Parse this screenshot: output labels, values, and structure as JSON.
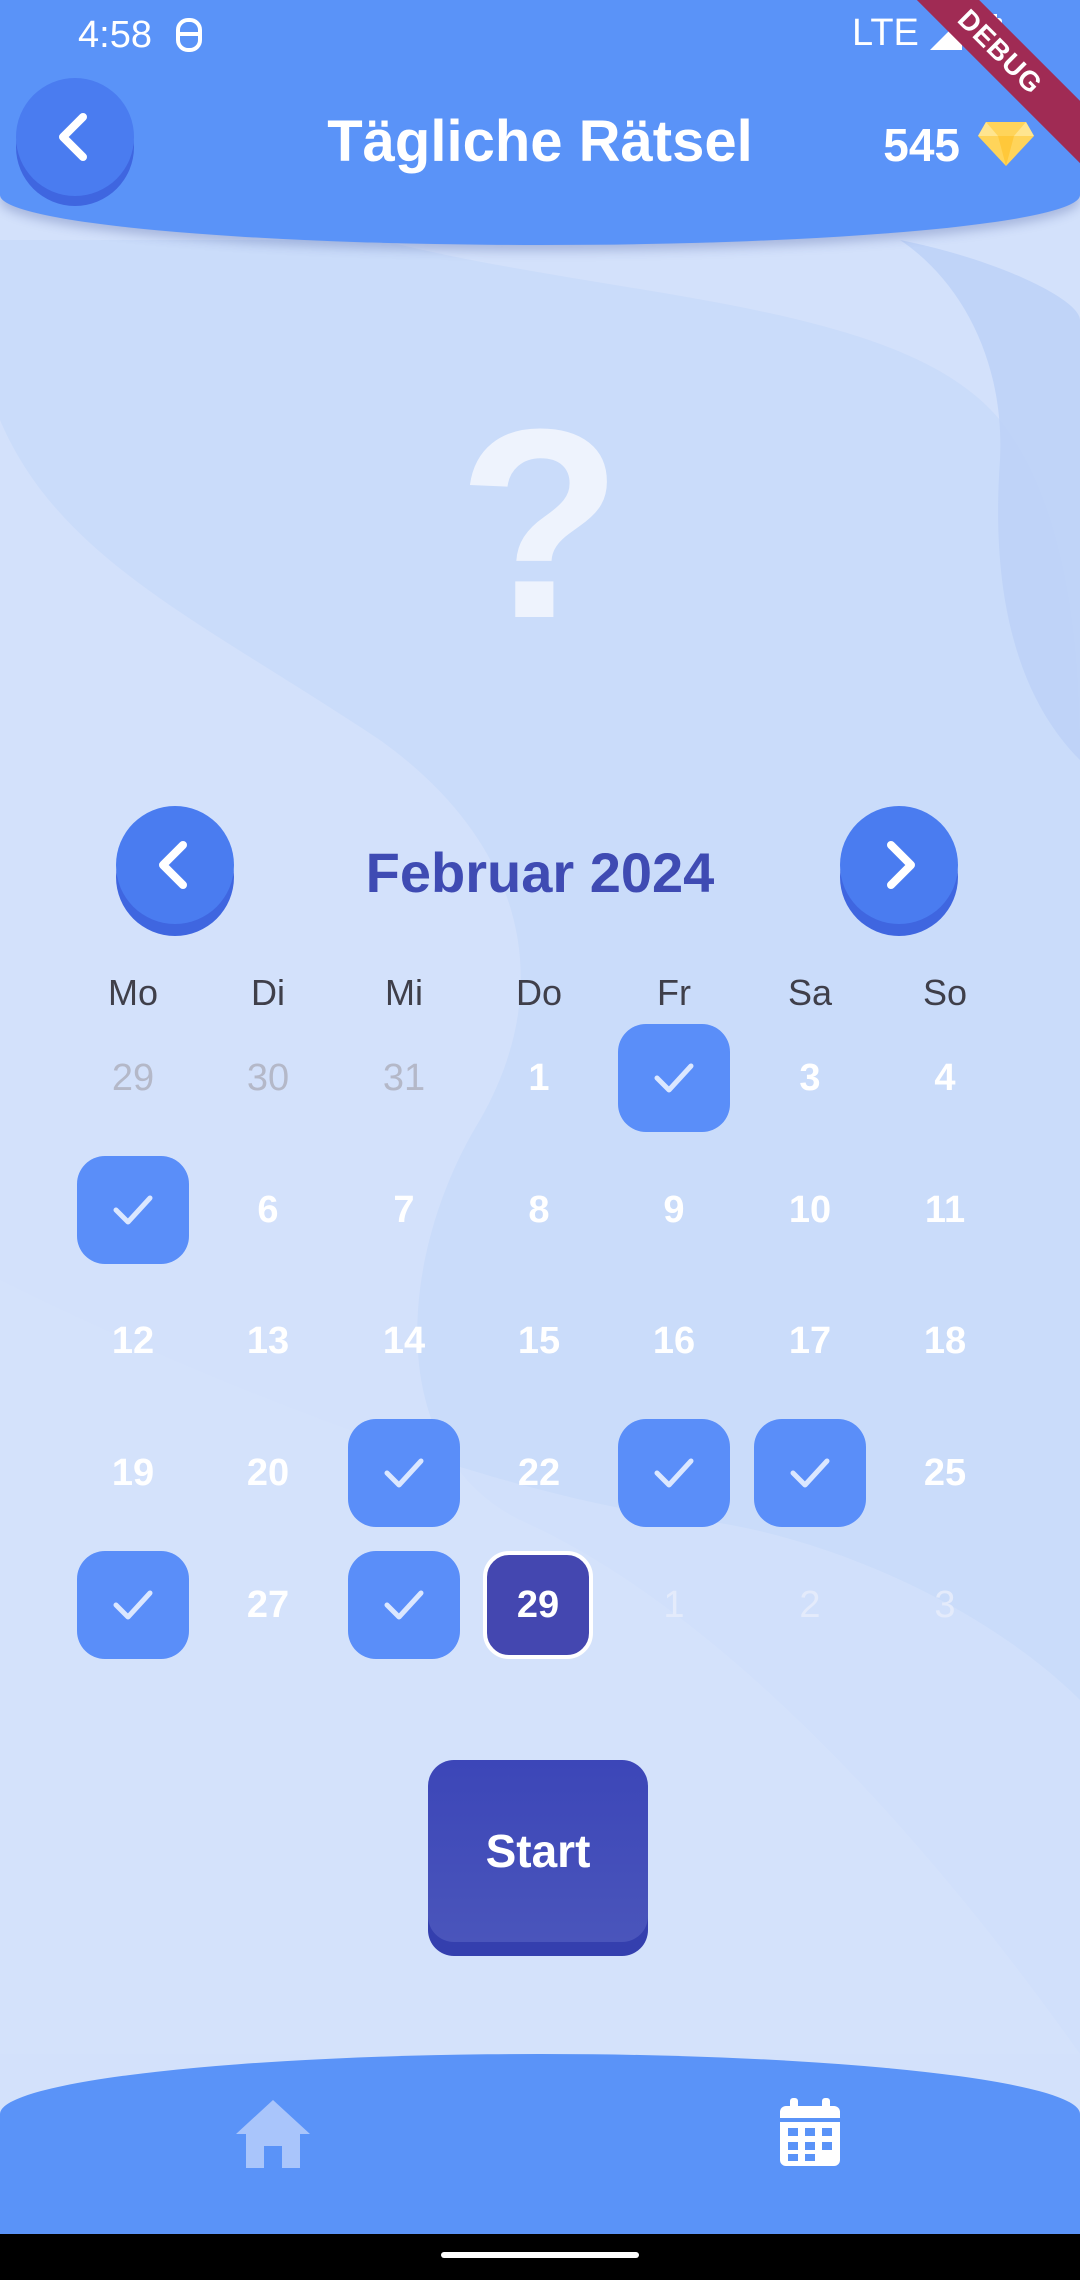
{
  "status_bar": {
    "time": "4:58",
    "network": "LTE",
    "debug": "DEBUG"
  },
  "header": {
    "title": "Tägliche Rätsel",
    "gems": "545"
  },
  "mystery_symbol": "?",
  "calendar": {
    "month_label": "Februar 2024",
    "weekdays": [
      "Mo",
      "Di",
      "Mi",
      "Do",
      "Fr",
      "Sa",
      "So"
    ],
    "weeks": [
      [
        {
          "label": "29",
          "state": "outside"
        },
        {
          "label": "30",
          "state": "outside"
        },
        {
          "label": "31",
          "state": "outside"
        },
        {
          "label": "1",
          "state": "normal"
        },
        {
          "label": "",
          "state": "done"
        },
        {
          "label": "3",
          "state": "normal"
        },
        {
          "label": "4",
          "state": "normal"
        }
      ],
      [
        {
          "label": "",
          "state": "done"
        },
        {
          "label": "6",
          "state": "normal"
        },
        {
          "label": "7",
          "state": "normal"
        },
        {
          "label": "8",
          "state": "normal"
        },
        {
          "label": "9",
          "state": "normal"
        },
        {
          "label": "10",
          "state": "normal"
        },
        {
          "label": "11",
          "state": "normal"
        }
      ],
      [
        {
          "label": "12",
          "state": "normal"
        },
        {
          "label": "13",
          "state": "normal"
        },
        {
          "label": "14",
          "state": "normal"
        },
        {
          "label": "15",
          "state": "normal"
        },
        {
          "label": "16",
          "state": "normal"
        },
        {
          "label": "17",
          "state": "normal"
        },
        {
          "label": "18",
          "state": "normal"
        }
      ],
      [
        {
          "label": "19",
          "state": "normal"
        },
        {
          "label": "20",
          "state": "normal"
        },
        {
          "label": "",
          "state": "done"
        },
        {
          "label": "22",
          "state": "normal"
        },
        {
          "label": "",
          "state": "done"
        },
        {
          "label": "",
          "state": "done"
        },
        {
          "label": "25",
          "state": "normal"
        }
      ],
      [
        {
          "label": "",
          "state": "done"
        },
        {
          "label": "27",
          "state": "normal"
        },
        {
          "label": "",
          "state": "done"
        },
        {
          "label": "29",
          "state": "today"
        },
        {
          "label": "1",
          "state": "future"
        },
        {
          "label": "2",
          "state": "future"
        },
        {
          "label": "3",
          "state": "future"
        }
      ]
    ]
  },
  "start_label": "Start",
  "bottom_nav": {
    "items": [
      "home-icon",
      "calendar-icon"
    ]
  },
  "colors": {
    "primary": "#5a93f8",
    "done": "#5a8ef9",
    "today": "#4447b0",
    "background": "#d3e1fb"
  }
}
